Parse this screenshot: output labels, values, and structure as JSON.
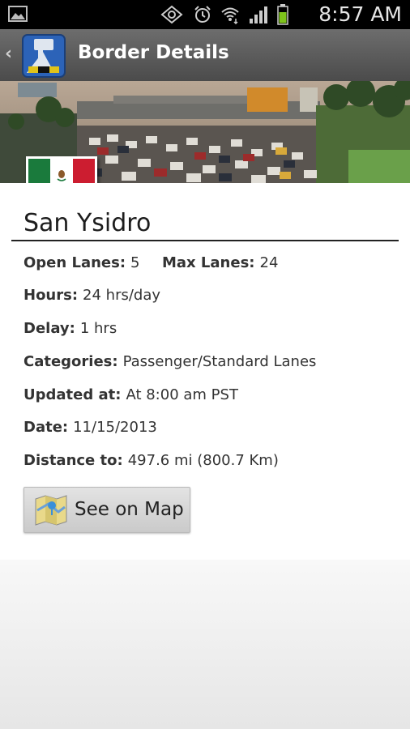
{
  "status_bar": {
    "time": "8:57 AM",
    "icons": [
      "gallery-icon",
      "nfc-icon",
      "alarm-icon",
      "wifi-icon",
      "signal-icon",
      "battery-icon"
    ]
  },
  "action_bar": {
    "title": "Border Details",
    "back_icon": "chevron-left-icon",
    "app_icon": "border-app-icon"
  },
  "border": {
    "country_flag": "Mexico",
    "name": "San Ysidro",
    "open_lanes_label": "Open Lanes:",
    "open_lanes": "5",
    "max_lanes_label": "Max Lanes:",
    "max_lanes": "24",
    "hours_label": "Hours:",
    "hours": "24 hrs/day",
    "delay_label": "Delay:",
    "delay": "1 hrs",
    "categories_label": "Categories:",
    "categories": "Passenger/Standard Lanes",
    "updated_label": "Updated at:",
    "updated": "At 8:00 am PST",
    "date_label": "Date:",
    "date": "11/15/2013",
    "distance_label": "Distance to:",
    "distance": "497.6 mi (800.7 Km)"
  },
  "map_button": {
    "label": "See on Map",
    "icon": "map-icon"
  }
}
